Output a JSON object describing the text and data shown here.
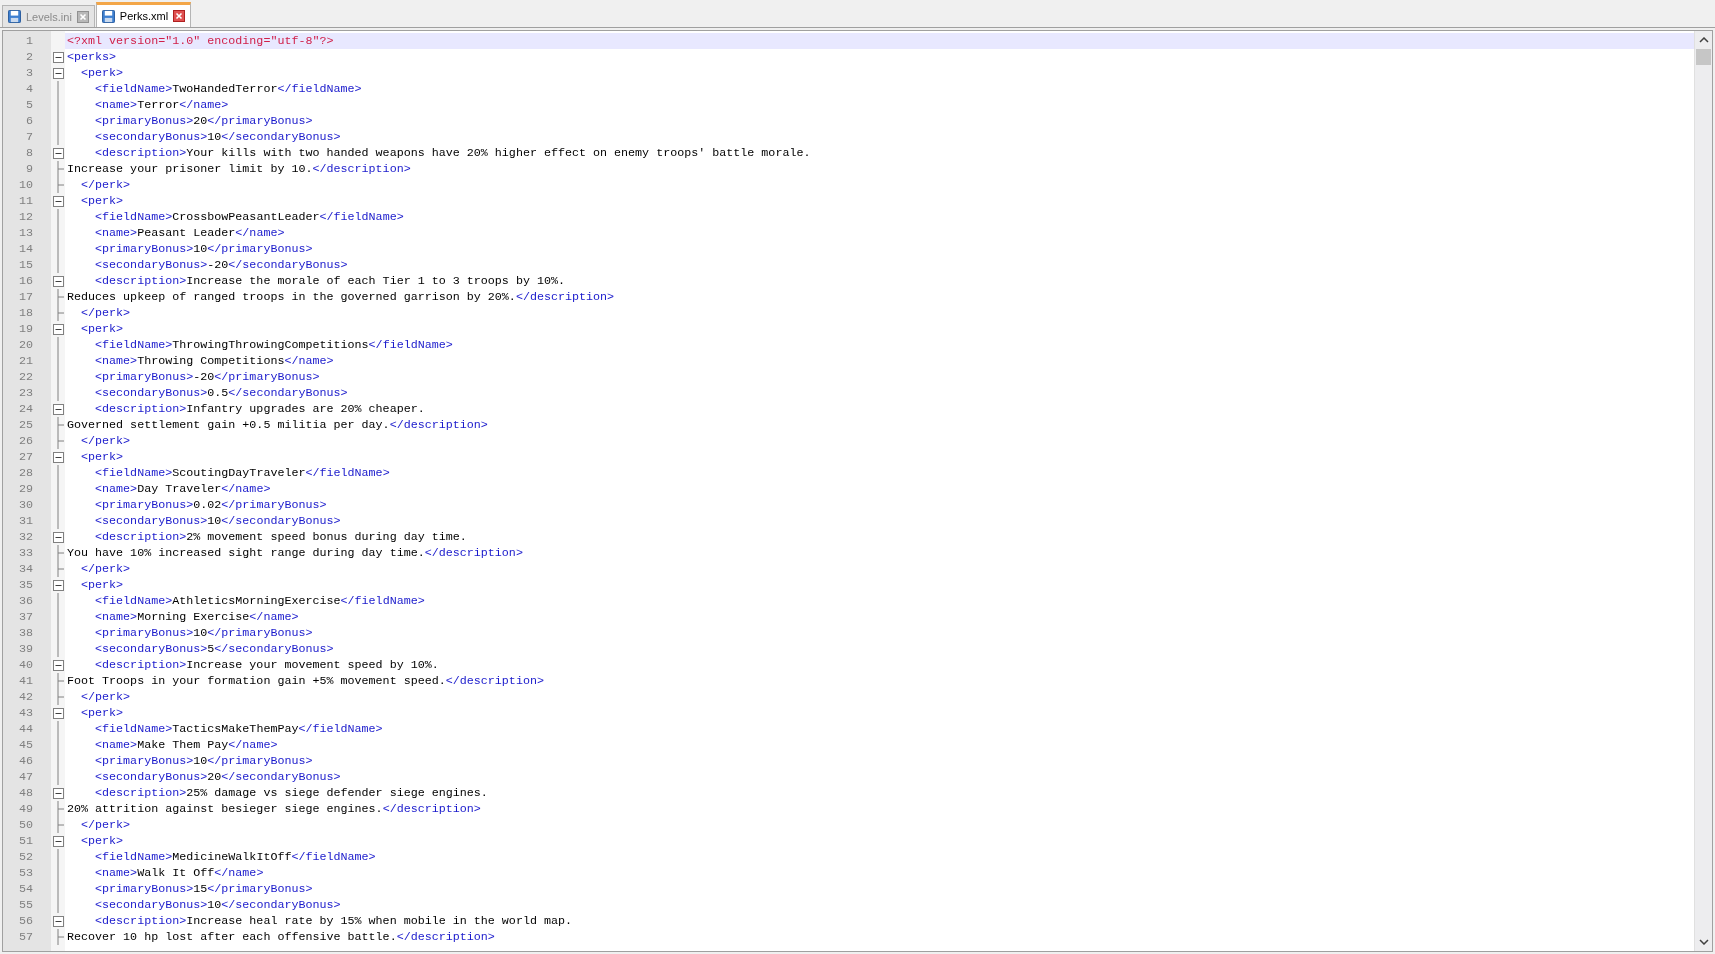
{
  "tabs": [
    {
      "label": "Levels.ini",
      "selected": false
    },
    {
      "label": "Perks.xml",
      "selected": true
    }
  ],
  "lines": [
    {
      "number": "1",
      "current": true,
      "kind": "plain",
      "tokens": [
        {
          "kind": "decl",
          "text": "<?xml version=\"1.0\" encoding=\"utf-8\"?>"
        }
      ]
    },
    {
      "number": "2",
      "current": false,
      "kind": "box",
      "tokens": [
        {
          "kind": "tag",
          "text": "<perks>"
        }
      ]
    },
    {
      "number": "3",
      "current": false,
      "kind": "box",
      "tokens": [
        {
          "kind": "tag",
          "text": "  <perk>"
        }
      ]
    },
    {
      "number": "4",
      "current": false,
      "kind": "guide",
      "tokens": [
        {
          "kind": "tag",
          "text": "    <fieldName>"
        },
        {
          "kind": "text",
          "text": "TwoHandedTerror"
        },
        {
          "kind": "tag",
          "text": "</fieldName>"
        }
      ]
    },
    {
      "number": "5",
      "current": false,
      "kind": "guide",
      "tokens": [
        {
          "kind": "tag",
          "text": "    <name>"
        },
        {
          "kind": "text",
          "text": "Terror"
        },
        {
          "kind": "tag",
          "text": "</name>"
        }
      ]
    },
    {
      "number": "6",
      "current": false,
      "kind": "guide",
      "tokens": [
        {
          "kind": "tag",
          "text": "    <primaryBonus>"
        },
        {
          "kind": "text",
          "text": "20"
        },
        {
          "kind": "tag",
          "text": "</primaryBonus>"
        }
      ]
    },
    {
      "number": "7",
      "current": false,
      "kind": "guide",
      "tokens": [
        {
          "kind": "tag",
          "text": "    <secondaryBonus>"
        },
        {
          "kind": "text",
          "text": "10"
        },
        {
          "kind": "tag",
          "text": "</secondaryBonus>"
        }
      ]
    },
    {
      "number": "8",
      "current": false,
      "kind": "box",
      "tokens": [
        {
          "kind": "tag",
          "text": "    <description>"
        },
        {
          "kind": "text",
          "text": "Your kills with two handed weapons have 20% higher effect on enemy troops' battle morale."
        }
      ]
    },
    {
      "number": "9",
      "current": false,
      "kind": "end",
      "tokens": [
        {
          "kind": "text",
          "text": "Increase your prisoner limit by 10."
        },
        {
          "kind": "tag",
          "text": "</description>"
        }
      ]
    },
    {
      "number": "10",
      "current": false,
      "kind": "end",
      "tokens": [
        {
          "kind": "tag",
          "text": "  </perk>"
        }
      ]
    },
    {
      "number": "11",
      "current": false,
      "kind": "box",
      "tokens": [
        {
          "kind": "tag",
          "text": "  <perk>"
        }
      ]
    },
    {
      "number": "12",
      "current": false,
      "kind": "guide",
      "tokens": [
        {
          "kind": "tag",
          "text": "    <fieldName>"
        },
        {
          "kind": "text",
          "text": "CrossbowPeasantLeader"
        },
        {
          "kind": "tag",
          "text": "</fieldName>"
        }
      ]
    },
    {
      "number": "13",
      "current": false,
      "kind": "guide",
      "tokens": [
        {
          "kind": "tag",
          "text": "    <name>"
        },
        {
          "kind": "text",
          "text": "Peasant Leader"
        },
        {
          "kind": "tag",
          "text": "</name>"
        }
      ]
    },
    {
      "number": "14",
      "current": false,
      "kind": "guide",
      "tokens": [
        {
          "kind": "tag",
          "text": "    <primaryBonus>"
        },
        {
          "kind": "text",
          "text": "10"
        },
        {
          "kind": "tag",
          "text": "</primaryBonus>"
        }
      ]
    },
    {
      "number": "15",
      "current": false,
      "kind": "guide",
      "tokens": [
        {
          "kind": "tag",
          "text": "    <secondaryBonus>"
        },
        {
          "kind": "text",
          "text": "-20"
        },
        {
          "kind": "tag",
          "text": "</secondaryBonus>"
        }
      ]
    },
    {
      "number": "16",
      "current": false,
      "kind": "box",
      "tokens": [
        {
          "kind": "tag",
          "text": "    <description>"
        },
        {
          "kind": "text",
          "text": "Increase the morale of each Tier 1 to 3 troops by 10%."
        }
      ]
    },
    {
      "number": "17",
      "current": false,
      "kind": "end",
      "tokens": [
        {
          "kind": "text",
          "text": "Reduces upkeep of ranged troops in the governed garrison by 20%."
        },
        {
          "kind": "tag",
          "text": "</description>"
        }
      ]
    },
    {
      "number": "18",
      "current": false,
      "kind": "end",
      "tokens": [
        {
          "kind": "tag",
          "text": "  </perk>"
        }
      ]
    },
    {
      "number": "19",
      "current": false,
      "kind": "box",
      "tokens": [
        {
          "kind": "tag",
          "text": "  <perk>"
        }
      ]
    },
    {
      "number": "20",
      "current": false,
      "kind": "guide",
      "tokens": [
        {
          "kind": "tag",
          "text": "    <fieldName>"
        },
        {
          "kind": "text",
          "text": "ThrowingThrowingCompetitions"
        },
        {
          "kind": "tag",
          "text": "</fieldName>"
        }
      ]
    },
    {
      "number": "21",
      "current": false,
      "kind": "guide",
      "tokens": [
        {
          "kind": "tag",
          "text": "    <name>"
        },
        {
          "kind": "text",
          "text": "Throwing Competitions"
        },
        {
          "kind": "tag",
          "text": "</name>"
        }
      ]
    },
    {
      "number": "22",
      "current": false,
      "kind": "guide",
      "tokens": [
        {
          "kind": "tag",
          "text": "    <primaryBonus>"
        },
        {
          "kind": "text",
          "text": "-20"
        },
        {
          "kind": "tag",
          "text": "</primaryBonus>"
        }
      ]
    },
    {
      "number": "23",
      "current": false,
      "kind": "guide",
      "tokens": [
        {
          "kind": "tag",
          "text": "    <secondaryBonus>"
        },
        {
          "kind": "text",
          "text": "0.5"
        },
        {
          "kind": "tag",
          "text": "</secondaryBonus>"
        }
      ]
    },
    {
      "number": "24",
      "current": false,
      "kind": "box",
      "tokens": [
        {
          "kind": "tag",
          "text": "    <description>"
        },
        {
          "kind": "text",
          "text": "Infantry upgrades are 20% cheaper."
        }
      ]
    },
    {
      "number": "25",
      "current": false,
      "kind": "end",
      "tokens": [
        {
          "kind": "text",
          "text": "Governed settlement gain +0.5 militia per day."
        },
        {
          "kind": "tag",
          "text": "</description>"
        }
      ]
    },
    {
      "number": "26",
      "current": false,
      "kind": "end",
      "tokens": [
        {
          "kind": "tag",
          "text": "  </perk>"
        }
      ]
    },
    {
      "number": "27",
      "current": false,
      "kind": "box",
      "tokens": [
        {
          "kind": "tag",
          "text": "  <perk>"
        }
      ]
    },
    {
      "number": "28",
      "current": false,
      "kind": "guide",
      "tokens": [
        {
          "kind": "tag",
          "text": "    <fieldName>"
        },
        {
          "kind": "text",
          "text": "ScoutingDayTraveler"
        },
        {
          "kind": "tag",
          "text": "</fieldName>"
        }
      ]
    },
    {
      "number": "29",
      "current": false,
      "kind": "guide",
      "tokens": [
        {
          "kind": "tag",
          "text": "    <name>"
        },
        {
          "kind": "text",
          "text": "Day Traveler"
        },
        {
          "kind": "tag",
          "text": "</name>"
        }
      ]
    },
    {
      "number": "30",
      "current": false,
      "kind": "guide",
      "tokens": [
        {
          "kind": "tag",
          "text": "    <primaryBonus>"
        },
        {
          "kind": "text",
          "text": "0.02"
        },
        {
          "kind": "tag",
          "text": "</primaryBonus>"
        }
      ]
    },
    {
      "number": "31",
      "current": false,
      "kind": "guide",
      "tokens": [
        {
          "kind": "tag",
          "text": "    <secondaryBonus>"
        },
        {
          "kind": "text",
          "text": "10"
        },
        {
          "kind": "tag",
          "text": "</secondaryBonus>"
        }
      ]
    },
    {
      "number": "32",
      "current": false,
      "kind": "box",
      "tokens": [
        {
          "kind": "tag",
          "text": "    <description>"
        },
        {
          "kind": "text",
          "text": "2% movement speed bonus during day time."
        }
      ]
    },
    {
      "number": "33",
      "current": false,
      "kind": "end",
      "tokens": [
        {
          "kind": "text",
          "text": "You have 10% increased sight range during day time."
        },
        {
          "kind": "tag",
          "text": "</description>"
        }
      ]
    },
    {
      "number": "34",
      "current": false,
      "kind": "end",
      "tokens": [
        {
          "kind": "tag",
          "text": "  </perk>"
        }
      ]
    },
    {
      "number": "35",
      "current": false,
      "kind": "box",
      "tokens": [
        {
          "kind": "tag",
          "text": "  <perk>"
        }
      ]
    },
    {
      "number": "36",
      "current": false,
      "kind": "guide",
      "tokens": [
        {
          "kind": "tag",
          "text": "    <fieldName>"
        },
        {
          "kind": "text",
          "text": "AthleticsMorningExercise"
        },
        {
          "kind": "tag",
          "text": "</fieldName>"
        }
      ]
    },
    {
      "number": "37",
      "current": false,
      "kind": "guide",
      "tokens": [
        {
          "kind": "tag",
          "text": "    <name>"
        },
        {
          "kind": "text",
          "text": "Morning Exercise"
        },
        {
          "kind": "tag",
          "text": "</name>"
        }
      ]
    },
    {
      "number": "38",
      "current": false,
      "kind": "guide",
      "tokens": [
        {
          "kind": "tag",
          "text": "    <primaryBonus>"
        },
        {
          "kind": "text",
          "text": "10"
        },
        {
          "kind": "tag",
          "text": "</primaryBonus>"
        }
      ]
    },
    {
      "number": "39",
      "current": false,
      "kind": "guide",
      "tokens": [
        {
          "kind": "tag",
          "text": "    <secondaryBonus>"
        },
        {
          "kind": "text",
          "text": "5"
        },
        {
          "kind": "tag",
          "text": "</secondaryBonus>"
        }
      ]
    },
    {
      "number": "40",
      "current": false,
      "kind": "box",
      "tokens": [
        {
          "kind": "tag",
          "text": "    <description>"
        },
        {
          "kind": "text",
          "text": "Increase your movement speed by 10%."
        }
      ]
    },
    {
      "number": "41",
      "current": false,
      "kind": "end",
      "tokens": [
        {
          "kind": "text",
          "text": "Foot Troops in your formation gain +5% movement speed."
        },
        {
          "kind": "tag",
          "text": "</description>"
        }
      ]
    },
    {
      "number": "42",
      "current": false,
      "kind": "end",
      "tokens": [
        {
          "kind": "tag",
          "text": "  </perk>"
        }
      ]
    },
    {
      "number": "43",
      "current": false,
      "kind": "box",
      "tokens": [
        {
          "kind": "tag",
          "text": "  <perk>"
        }
      ]
    },
    {
      "number": "44",
      "current": false,
      "kind": "guide",
      "tokens": [
        {
          "kind": "tag",
          "text": "    <fieldName>"
        },
        {
          "kind": "text",
          "text": "TacticsMakeThemPay"
        },
        {
          "kind": "tag",
          "text": "</fieldName>"
        }
      ]
    },
    {
      "number": "45",
      "current": false,
      "kind": "guide",
      "tokens": [
        {
          "kind": "tag",
          "text": "    <name>"
        },
        {
          "kind": "text",
          "text": "Make Them Pay"
        },
        {
          "kind": "tag",
          "text": "</name>"
        }
      ]
    },
    {
      "number": "46",
      "current": false,
      "kind": "guide",
      "tokens": [
        {
          "kind": "tag",
          "text": "    <primaryBonus>"
        },
        {
          "kind": "text",
          "text": "10"
        },
        {
          "kind": "tag",
          "text": "</primaryBonus>"
        }
      ]
    },
    {
      "number": "47",
      "current": false,
      "kind": "guide",
      "tokens": [
        {
          "kind": "tag",
          "text": "    <secondaryBonus>"
        },
        {
          "kind": "text",
          "text": "20"
        },
        {
          "kind": "tag",
          "text": "</secondaryBonus>"
        }
      ]
    },
    {
      "number": "48",
      "current": false,
      "kind": "box",
      "tokens": [
        {
          "kind": "tag",
          "text": "    <description>"
        },
        {
          "kind": "text",
          "text": "25% damage vs siege defender siege engines."
        }
      ]
    },
    {
      "number": "49",
      "current": false,
      "kind": "end",
      "tokens": [
        {
          "kind": "text",
          "text": "20% attrition against besieger siege engines."
        },
        {
          "kind": "tag",
          "text": "</description>"
        }
      ]
    },
    {
      "number": "50",
      "current": false,
      "kind": "end",
      "tokens": [
        {
          "kind": "tag",
          "text": "  </perk>"
        }
      ]
    },
    {
      "number": "51",
      "current": false,
      "kind": "box",
      "tokens": [
        {
          "kind": "tag",
          "text": "  <perk>"
        }
      ]
    },
    {
      "number": "52",
      "current": false,
      "kind": "guide",
      "tokens": [
        {
          "kind": "tag",
          "text": "    <fieldName>"
        },
        {
          "kind": "text",
          "text": "MedicineWalkItOff"
        },
        {
          "kind": "tag",
          "text": "</fieldName>"
        }
      ]
    },
    {
      "number": "53",
      "current": false,
      "kind": "guide",
      "tokens": [
        {
          "kind": "tag",
          "text": "    <name>"
        },
        {
          "kind": "text",
          "text": "Walk It Off"
        },
        {
          "kind": "tag",
          "text": "</name>"
        }
      ]
    },
    {
      "number": "54",
      "current": false,
      "kind": "guide",
      "tokens": [
        {
          "kind": "tag",
          "text": "    <primaryBonus>"
        },
        {
          "kind": "text",
          "text": "15"
        },
        {
          "kind": "tag",
          "text": "</primaryBonus>"
        }
      ]
    },
    {
      "number": "55",
      "current": false,
      "kind": "guide",
      "tokens": [
        {
          "kind": "tag",
          "text": "    <secondaryBonus>"
        },
        {
          "kind": "text",
          "text": "10"
        },
        {
          "kind": "tag",
          "text": "</secondaryBonus>"
        }
      ]
    },
    {
      "number": "56",
      "current": false,
      "kind": "box",
      "tokens": [
        {
          "kind": "tag",
          "text": "    <description>"
        },
        {
          "kind": "text",
          "text": "Increase heal rate by 15% when mobile in the world map."
        }
      ]
    },
    {
      "number": "57",
      "current": false,
      "kind": "end",
      "tokens": [
        {
          "kind": "text",
          "text": "Recover 10 hp lost after each offensive battle."
        },
        {
          "kind": "tag",
          "text": "</description>"
        }
      ]
    }
  ]
}
